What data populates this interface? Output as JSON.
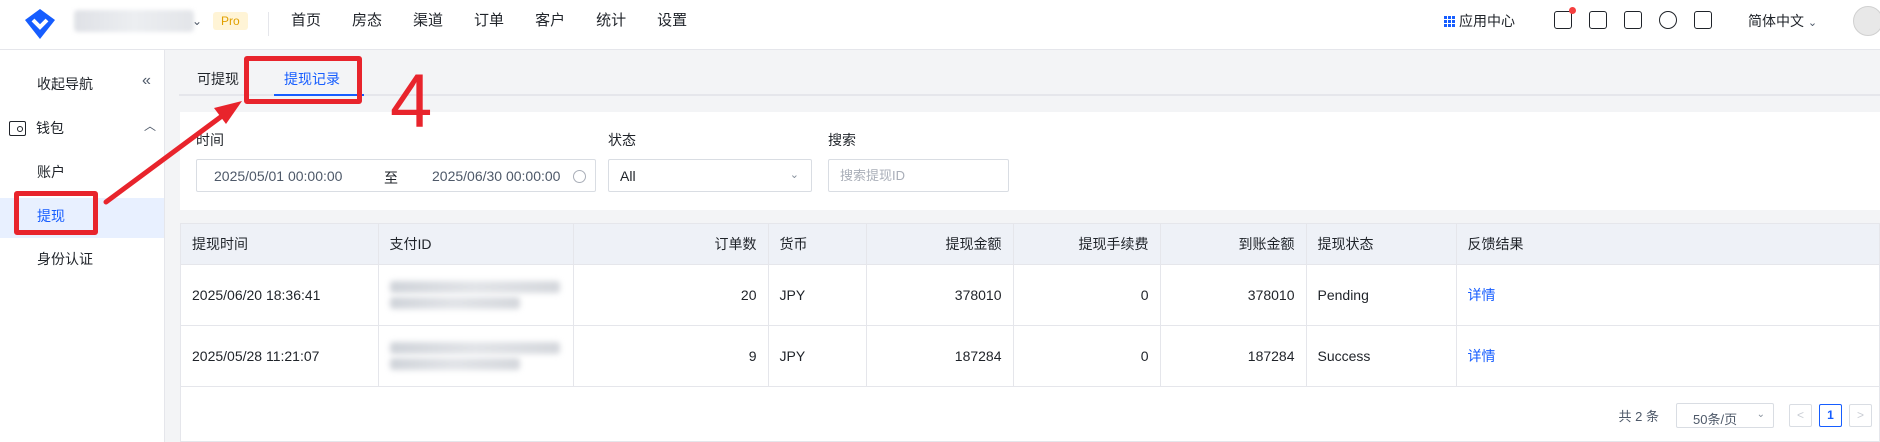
{
  "topbar": {
    "pro_badge": "Pro",
    "nav": [
      "首页",
      "房态",
      "渠道",
      "订单",
      "客户",
      "统计",
      "设置"
    ],
    "app_center": "应用中心",
    "language": "简体中文"
  },
  "sidebar": {
    "collapse": "收起导航",
    "wallet": "钱包",
    "items": [
      "账户",
      "提现",
      "身份认证"
    ]
  },
  "tabs": [
    "可提现",
    "提现记录"
  ],
  "filters": {
    "time_label": "时间",
    "start": "2025/05/01 00:00:00",
    "to": "至",
    "end": "2025/06/30 00:00:00",
    "status_label": "状态",
    "status_value": "All",
    "search_label": "搜索",
    "search_placeholder": "搜索提现ID"
  },
  "table": {
    "headers": [
      "提现时间",
      "支付ID",
      "订单数",
      "货币",
      "提现金额",
      "提现手续费",
      "到账金额",
      "提现状态",
      "反馈结果"
    ],
    "rows": [
      {
        "time": "2025/06/20 18:36:41",
        "orders": "20",
        "currency": "JPY",
        "amount": "378010",
        "fee": "0",
        "received": "378010",
        "status": "Pending",
        "feedback": "详情"
      },
      {
        "time": "2025/05/28 11:21:07",
        "orders": "9",
        "currency": "JPY",
        "amount": "187284",
        "fee": "0",
        "received": "187284",
        "status": "Success",
        "feedback": "详情"
      }
    ]
  },
  "pagination": {
    "total": "共 2 条",
    "page_size": "50条/页",
    "prev": "<",
    "current": "1",
    "next": ">"
  },
  "annotation": {
    "step_number": "4"
  },
  "colors": {
    "accent": "#165dff",
    "annotation": "#e8242c"
  }
}
